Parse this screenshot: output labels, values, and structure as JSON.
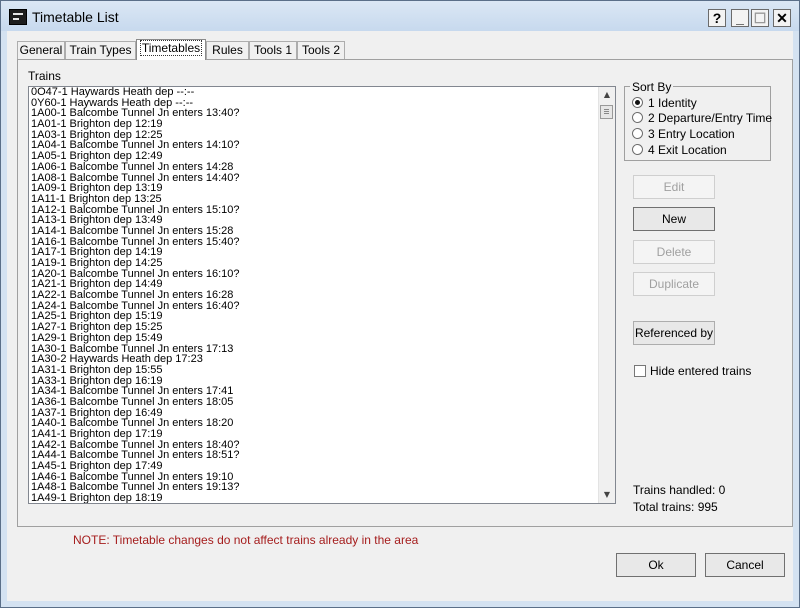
{
  "window": {
    "title": "Timetable List"
  },
  "titlebar_buttons": [
    "?",
    "_",
    "☐",
    "✕"
  ],
  "tabs": [
    {
      "label": "General"
    },
    {
      "label": "Train Types"
    },
    {
      "label": "Timetables"
    },
    {
      "label": "Rules"
    },
    {
      "label": "Tools 1"
    },
    {
      "label": "Tools 2"
    }
  ],
  "trains": {
    "label": "Trains",
    "items": [
      "0O47-1 Haywards Heath dep --:--",
      "0Y60-1 Haywards Heath dep --:--",
      "1A00-1 Balcombe Tunnel Jn enters 13:40?",
      "1A01-1 Brighton dep 12:19",
      "1A03-1 Brighton dep 12:25",
      "1A04-1 Balcombe Tunnel Jn enters 14:10?",
      "1A05-1 Brighton dep 12:49",
      "1A06-1 Balcombe Tunnel Jn enters 14:28",
      "1A08-1 Balcombe Tunnel Jn enters 14:40?",
      "1A09-1 Brighton dep 13:19",
      "1A11-1 Brighton dep 13:25",
      "1A12-1 Balcombe Tunnel Jn enters 15:10?",
      "1A13-1 Brighton dep 13:49",
      "1A14-1 Balcombe Tunnel Jn enters 15:28",
      "1A16-1 Balcombe Tunnel Jn enters 15:40?",
      "1A17-1 Brighton dep 14:19",
      "1A19-1 Brighton dep 14:25",
      "1A20-1 Balcombe Tunnel Jn enters 16:10?",
      "1A21-1 Brighton dep 14:49",
      "1A22-1 Balcombe Tunnel Jn enters 16:28",
      "1A24-1 Balcombe Tunnel Jn enters 16:40?",
      "1A25-1 Brighton dep 15:19",
      "1A27-1 Brighton dep 15:25",
      "1A29-1 Brighton dep 15:49",
      "1A30-1 Balcombe Tunnel Jn enters 17:13",
      "1A30-2 Haywards Heath dep 17:23",
      "1A31-1 Brighton dep 15:55",
      "1A33-1 Brighton dep 16:19",
      "1A34-1 Balcombe Tunnel Jn enters 17:41",
      "1A36-1 Balcombe Tunnel Jn enters 18:05",
      "1A37-1 Brighton dep 16:49",
      "1A40-1 Balcombe Tunnel Jn enters 18:20",
      "1A41-1 Brighton dep 17:19",
      "1A42-1 Balcombe Tunnel Jn enters 18:40?",
      "1A44-1 Balcombe Tunnel Jn enters 18:51?",
      "1A45-1 Brighton dep 17:49",
      "1A46-1 Balcombe Tunnel Jn enters 19:10",
      "1A48-1 Balcombe Tunnel Jn enters 19:13?",
      "1A49-1 Brighton dep 18:19"
    ]
  },
  "sort_by": {
    "title": "Sort By",
    "options": [
      {
        "label": "1 Identity",
        "checked": true
      },
      {
        "label": "2 Departure/Entry Time",
        "checked": false
      },
      {
        "label": "3 Entry Location",
        "checked": false
      },
      {
        "label": "4 Exit Location",
        "checked": false
      }
    ]
  },
  "buttons": {
    "edit": "Edit",
    "new": "New",
    "delete": "Delete",
    "duplicate": "Duplicate",
    "referenced_by": "Referenced by"
  },
  "hide_entered_trains": {
    "label": "Hide entered trains",
    "checked": false
  },
  "stats": {
    "handled": "Trains handled: 0",
    "total": "Total trains: 995"
  },
  "note": "NOTE: Timetable changes do not affect trains already in the area",
  "footer": {
    "ok": "Ok",
    "cancel": "Cancel"
  },
  "colors": {
    "note": "#a51d1d",
    "window_frame": "#d4e2f1"
  }
}
